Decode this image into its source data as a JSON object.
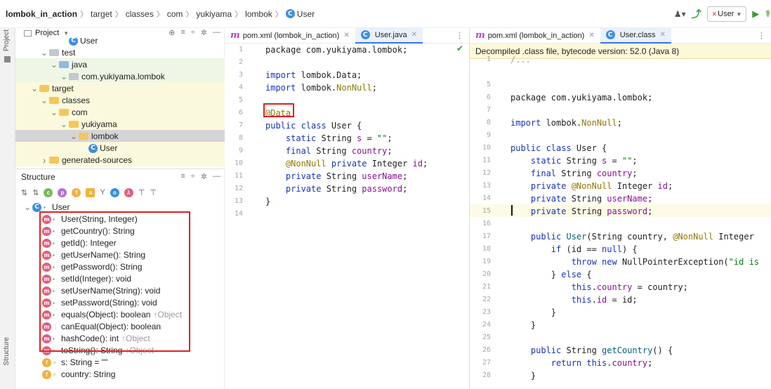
{
  "breadcrumb": [
    {
      "label": "lombok_in_action",
      "bold": true
    },
    {
      "label": "target"
    },
    {
      "label": "classes"
    },
    {
      "label": "com"
    },
    {
      "label": "yukiyama"
    },
    {
      "label": "lombok"
    },
    {
      "label": "User",
      "icon": "C"
    }
  ],
  "nav_right": {
    "run_config": "User",
    "icons": [
      "user-icon",
      "hammer-icon",
      "run-icon",
      "debug-icon"
    ]
  },
  "side_stripes": {
    "top": "Project",
    "bottom": "Structure"
  },
  "project": {
    "title": "Project",
    "tools": [
      "⊕",
      "≡",
      "÷",
      "✲",
      "—"
    ],
    "tree": [
      {
        "label": "User",
        "depth": 3,
        "icon": "class",
        "cut": true
      },
      {
        "label": "test",
        "depth": 1,
        "icon": "folder-grey",
        "expanded": true
      },
      {
        "label": "java",
        "depth": 2,
        "icon": "folder-green",
        "expanded": true,
        "bg": "green"
      },
      {
        "label": "com.yukiyama.lombok",
        "depth": 3,
        "icon": "folder-pkg",
        "expanded": true,
        "bg": "green"
      },
      {
        "label": "target",
        "depth": 0,
        "icon": "folder-yellow",
        "expanded": true,
        "bg": "yellow"
      },
      {
        "label": "classes",
        "depth": 1,
        "icon": "folder-yellow",
        "expanded": true,
        "bg": "yellow"
      },
      {
        "label": "com",
        "depth": 2,
        "icon": "folder-yellow",
        "expanded": true,
        "bg": "yellow"
      },
      {
        "label": "yukiyama",
        "depth": 3,
        "icon": "folder-yellow",
        "expanded": true,
        "bg": "yellow"
      },
      {
        "label": "lombok",
        "depth": 4,
        "icon": "folder-yellow",
        "expanded": true,
        "bg": "sel"
      },
      {
        "label": "User",
        "depth": 5,
        "icon": "class",
        "bg": "yellow"
      },
      {
        "label": "generated-sources",
        "depth": 1,
        "icon": "folder-yellow",
        "expanded": false,
        "bg": "yellow"
      }
    ]
  },
  "structure": {
    "title": "Structure",
    "tools": [
      "≡",
      "÷",
      "✲",
      "—"
    ],
    "root": "User",
    "members": [
      {
        "label": "User(String, Integer)",
        "kind": "m",
        "vis": "public",
        "inherit": ""
      },
      {
        "label": "getCountry(): String",
        "kind": "m",
        "vis": "public",
        "inherit": ""
      },
      {
        "label": "getId(): Integer",
        "kind": "m",
        "vis": "public",
        "inherit": ""
      },
      {
        "label": "getUserName(): String",
        "kind": "m",
        "vis": "public",
        "inherit": ""
      },
      {
        "label": "getPassword(): String",
        "kind": "m",
        "vis": "public",
        "inherit": ""
      },
      {
        "label": "setId(Integer): void",
        "kind": "m",
        "vis": "public",
        "inherit": ""
      },
      {
        "label": "setUserName(String): void",
        "kind": "m",
        "vis": "public",
        "inherit": ""
      },
      {
        "label": "setPassword(String): void",
        "kind": "m",
        "vis": "public",
        "inherit": ""
      },
      {
        "label": "equals(Object): boolean",
        "kind": "m",
        "vis": "public",
        "inherit": "↑Object"
      },
      {
        "label": "canEqual(Object): boolean",
        "kind": "m",
        "vis": "protected",
        "inherit": ""
      },
      {
        "label": "hashCode(): int",
        "kind": "m",
        "vis": "public",
        "inherit": "↑Object"
      },
      {
        "label": "toString(): String",
        "kind": "m",
        "vis": "public",
        "inherit": "↑Object"
      },
      {
        "label": "s: String = \"\"",
        "kind": "f",
        "vis": "package",
        "inherit": ""
      },
      {
        "label": "country: String",
        "kind": "f",
        "vis": "package",
        "inherit": ""
      }
    ]
  },
  "left_editor": {
    "tabs": [
      {
        "label": "pom.xml (lombok_in_action)",
        "icon": "m",
        "active": false
      },
      {
        "label": "User.java",
        "icon": "C",
        "active": true
      }
    ],
    "lines": [
      [
        [
          "package com.yukiyama.lombok;",
          ""
        ]
      ],
      [],
      [
        [
          "import",
          "k"
        ],
        [
          " lombok.Data;",
          ""
        ]
      ],
      [
        [
          "import",
          "k"
        ],
        [
          " lombok.",
          ""
        ],
        [
          "NonNull",
          "ann"
        ],
        [
          ";",
          ""
        ]
      ],
      [],
      [
        [
          "@Data",
          "ann"
        ]
      ],
      [
        [
          "public class",
          "k"
        ],
        [
          " User {",
          ""
        ]
      ],
      [
        [
          "    static",
          "k"
        ],
        [
          " String ",
          ""
        ],
        [
          "s",
          "fld"
        ],
        [
          " = ",
          ""
        ],
        [
          "\"\"",
          "str"
        ],
        [
          ";",
          ""
        ]
      ],
      [
        [
          "    final",
          "k"
        ],
        [
          " String ",
          ""
        ],
        [
          "country",
          "fld"
        ],
        [
          ";",
          ""
        ]
      ],
      [
        [
          "    @NonNull",
          "ann"
        ],
        [
          " private",
          "k"
        ],
        [
          " Integer ",
          ""
        ],
        [
          "id",
          "fld"
        ],
        [
          ";",
          ""
        ]
      ],
      [
        [
          "    private",
          "k"
        ],
        [
          " String ",
          ""
        ],
        [
          "userName",
          "fld"
        ],
        [
          ";",
          ""
        ]
      ],
      [
        [
          "    private",
          "k"
        ],
        [
          " String ",
          ""
        ],
        [
          "password",
          "fld"
        ],
        [
          ";",
          ""
        ]
      ],
      [
        [
          "}",
          ""
        ]
      ],
      []
    ]
  },
  "right_editor": {
    "tabs": [
      {
        "label": "pom.xml (lombok_in_action)",
        "icon": "m",
        "active": false
      },
      {
        "label": "User.class",
        "icon": "C",
        "active": true
      }
    ],
    "banner": "Decompiled .class file, bytecode version: 52.0 (Java 8)",
    "line_numbers": [
      "1",
      "",
      "5",
      "6",
      "7",
      "8",
      "9",
      "10",
      "11",
      "12",
      "13",
      "14",
      "15",
      "16",
      "17",
      "18",
      "19",
      "20",
      "21",
      "22",
      "23",
      "24",
      "25",
      "26",
      "27",
      "28"
    ],
    "lines": [
      [
        [
          "/...",
          "fold"
        ]
      ],
      [],
      [],
      [
        [
          "package com.yukiyama.lombok;",
          ""
        ]
      ],
      [],
      [
        [
          "import",
          "k"
        ],
        [
          " lombok.",
          ""
        ],
        [
          "NonNull",
          "ann"
        ],
        [
          ";",
          ""
        ]
      ],
      [],
      [
        [
          "public class",
          "k"
        ],
        [
          " User {",
          ""
        ]
      ],
      [
        [
          "    static",
          "k"
        ],
        [
          " String ",
          ""
        ],
        [
          "s",
          "fld"
        ],
        [
          " = ",
          ""
        ],
        [
          "\"\"",
          "str"
        ],
        [
          ";",
          ""
        ]
      ],
      [
        [
          "    final",
          "k"
        ],
        [
          " String ",
          ""
        ],
        [
          "country",
          "fld"
        ],
        [
          ";",
          ""
        ]
      ],
      [
        [
          "    private",
          "k"
        ],
        [
          " @NonNull",
          "ann"
        ],
        [
          " Integer ",
          ""
        ],
        [
          "id",
          "fld"
        ],
        [
          ";",
          ""
        ]
      ],
      [
        [
          "    private",
          "k"
        ],
        [
          " String ",
          ""
        ],
        [
          "userName",
          "fld"
        ],
        [
          ";",
          ""
        ]
      ],
      [
        [
          "    private",
          "k"
        ],
        [
          " String ",
          ""
        ],
        [
          "password",
          "fld"
        ],
        [
          ";",
          ""
        ]
      ],
      [],
      [
        [
          "    public",
          "k"
        ],
        [
          " User",
          "meth"
        ],
        [
          "(String country, ",
          ""
        ],
        [
          "@NonNull",
          "ann"
        ],
        [
          " Integer",
          ""
        ]
      ],
      [
        [
          "        if",
          "k"
        ],
        [
          " (id == ",
          ""
        ],
        [
          "null",
          "k"
        ],
        [
          ") {",
          ""
        ]
      ],
      [
        [
          "            throw new",
          "k"
        ],
        [
          " NullPointerException(",
          ""
        ],
        [
          "\"id is",
          "str"
        ]
      ],
      [
        [
          "        } ",
          ""
        ],
        [
          "else",
          "k"
        ],
        [
          " {",
          ""
        ]
      ],
      [
        [
          "            this",
          "k"
        ],
        [
          ".",
          ""
        ],
        [
          "country",
          "fld"
        ],
        [
          " = country;",
          ""
        ]
      ],
      [
        [
          "            this",
          "k"
        ],
        [
          ".",
          ""
        ],
        [
          "id",
          "fld"
        ],
        [
          " = id;",
          ""
        ]
      ],
      [
        [
          "        }",
          ""
        ]
      ],
      [
        [
          "    }",
          ""
        ]
      ],
      [],
      [
        [
          "    public",
          "k"
        ],
        [
          " String ",
          ""
        ],
        [
          "getCountry",
          "meth"
        ],
        [
          "() {",
          ""
        ]
      ],
      [
        [
          "        return this",
          "k"
        ],
        [
          ".",
          ""
        ],
        [
          "country",
          "fld"
        ],
        [
          ";",
          ""
        ]
      ],
      [
        [
          "    }",
          ""
        ]
      ]
    ]
  }
}
